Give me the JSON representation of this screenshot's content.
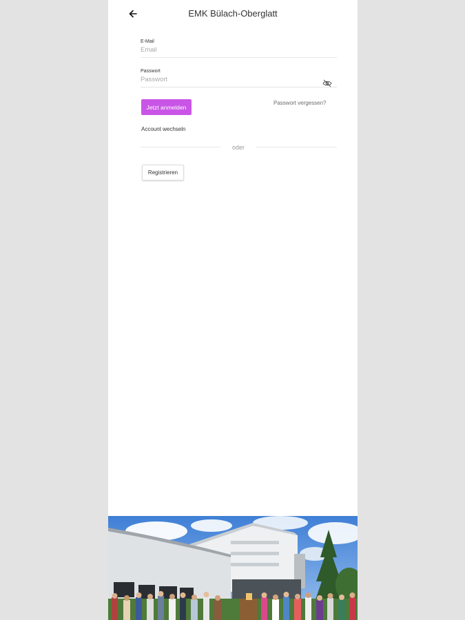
{
  "header": {
    "title": "EMK Bülach-Oberglatt",
    "back_icon": "arrow-left-icon"
  },
  "form": {
    "email": {
      "label": "E-Mail",
      "placeholder": "Email",
      "value": ""
    },
    "password": {
      "label": "Passwort",
      "placeholder": "Passwort",
      "value": "",
      "toggle_icon": "eye-off-icon"
    },
    "login_label": "Jetzt anmelden",
    "forgot_label": "Passwort vergessen?",
    "switch_label": "Account wechseln",
    "divider_label": "oder",
    "register_label": "Registrieren"
  },
  "colors": {
    "accent": "#c955e6",
    "background": "#e3e3e3",
    "card": "#ffffff"
  },
  "photo": {
    "subject": "church-building-group-photo"
  }
}
